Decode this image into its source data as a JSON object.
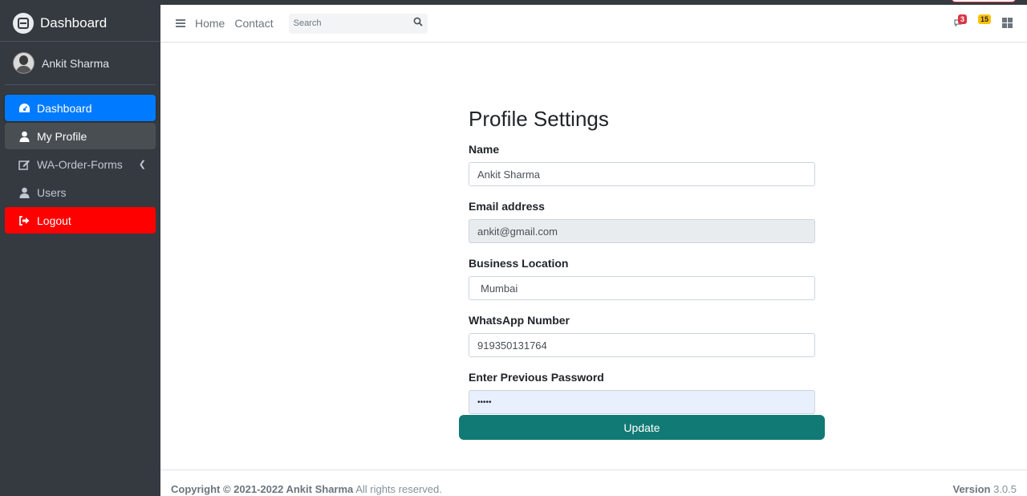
{
  "sidebar": {
    "brand": "Dashboard",
    "user_name": "Ankit Sharma",
    "items": [
      {
        "label": "Dashboard",
        "icon": "tachometer-icon",
        "state": "active"
      },
      {
        "label": "My Profile",
        "icon": "user-icon",
        "state": "hover"
      },
      {
        "label": "WA-Order-Forms",
        "icon": "edit-icon",
        "state": "normal"
      },
      {
        "label": "Users",
        "icon": "user-icon",
        "state": "normal"
      },
      {
        "label": "Logout",
        "icon": "sign-out-icon",
        "state": "danger"
      }
    ]
  },
  "header": {
    "home": "Home",
    "contact": "Contact",
    "search_placeholder": "Search",
    "messages_badge": "3",
    "notifications_badge": "15"
  },
  "form": {
    "title": "Profile Settings",
    "name_label": "Name",
    "name_value": "Ankit Sharma",
    "email_label": "Email address",
    "email_value": "ankit@gmail.com",
    "location_label": "Business Location",
    "location_value": "Mumbai",
    "whatsapp_label": "WhatsApp Number",
    "whatsapp_value": "919350131764",
    "password_label": "Enter Previous Password",
    "password_value": "•••••",
    "update_label": "Update"
  },
  "footer": {
    "copyright_bold": "Copyright © 2021-2022 Ankit Sharma",
    "copyright_rest": " All rights reserved.",
    "version_label": "Version",
    "version_value": " 3.0.5"
  },
  "colors": {
    "sidebar_bg": "#343a40",
    "active": "#007bff",
    "logout": "#ff0000",
    "update_btn": "#117a74"
  }
}
